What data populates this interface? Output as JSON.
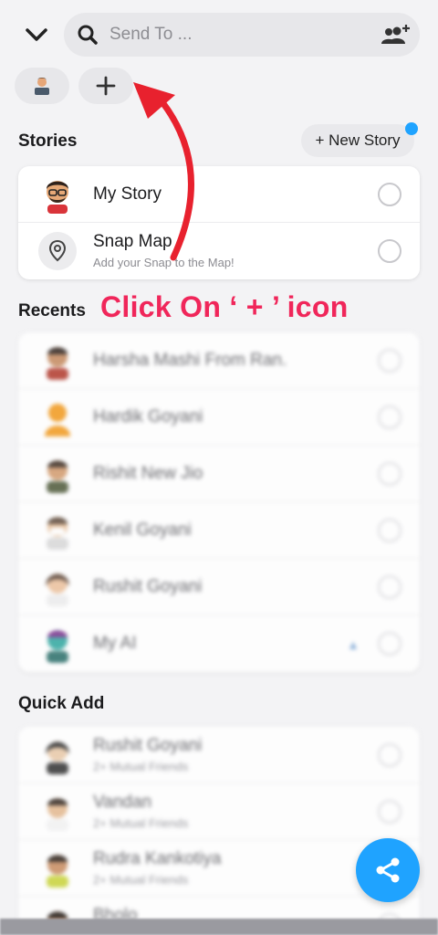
{
  "search": {
    "placeholder": "Send To ..."
  },
  "sections": {
    "stories": "Stories",
    "recents": "Recents",
    "quick_add": "Quick Add"
  },
  "new_story_label": "+ New Story",
  "stories": [
    {
      "name": "My Story",
      "subtitle": ""
    },
    {
      "name": "Snap Map",
      "subtitle": "Add your Snap to the Map!"
    }
  ],
  "recents": [
    {
      "name": "Harsha Mashi From Ran."
    },
    {
      "name": "Hardik Goyani"
    },
    {
      "name": "Rishit New Jio"
    },
    {
      "name": "Kenil Goyani"
    },
    {
      "name": "Rushit Goyani"
    },
    {
      "name": "My AI"
    }
  ],
  "quick_add": [
    {
      "name": "Rushit Goyani",
      "subtitle": "2+ Mutual Friends"
    },
    {
      "name": "Vandan",
      "subtitle": "2+ Mutual Friends"
    },
    {
      "name": "Rudra Kankotiya",
      "subtitle": "2+ Mutual Friends"
    },
    {
      "name": "Bholo",
      "subtitle": ""
    }
  ],
  "annotation": "Click On ‘ + ’  icon",
  "colors": {
    "accent": "#1fa3ff",
    "annotation": "#f0265a",
    "arrow": "#e8212e"
  },
  "icons": [
    "chevron-down-icon",
    "search-icon",
    "add-friend-icon",
    "plus-icon",
    "map-pin-icon",
    "share-icon"
  ]
}
